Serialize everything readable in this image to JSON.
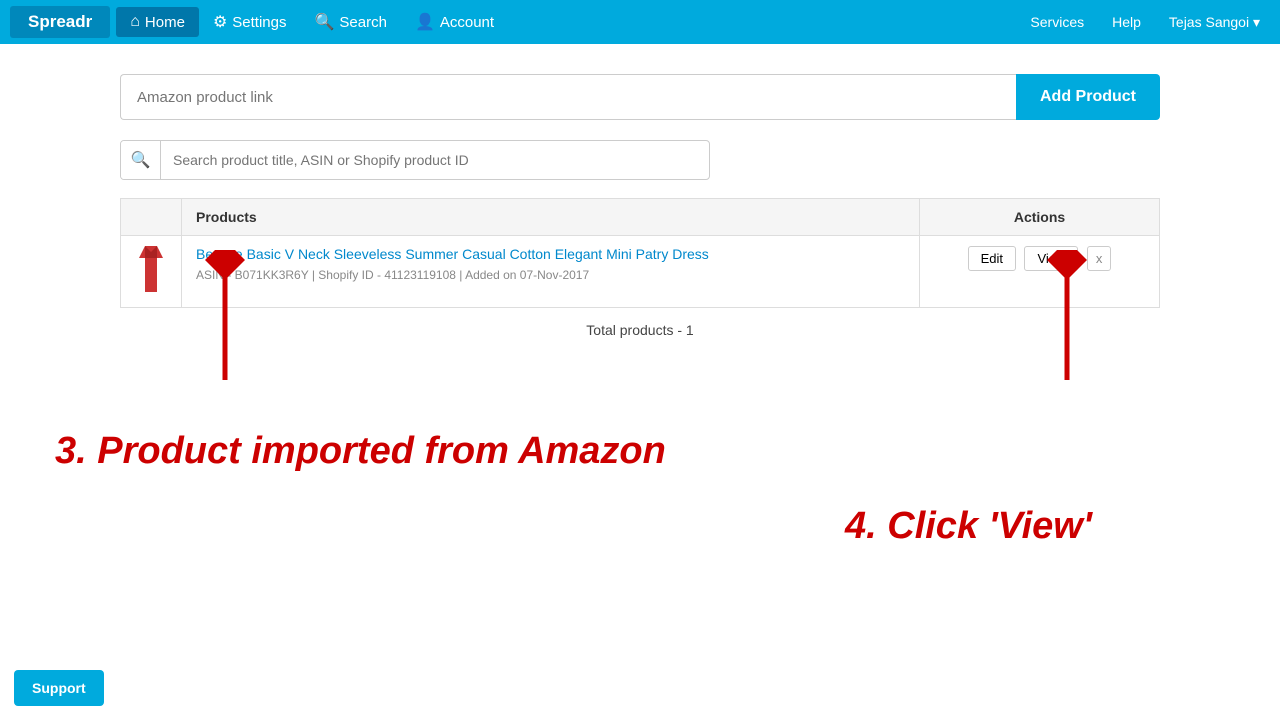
{
  "navbar": {
    "brand": "Spreadr",
    "home_label": "Home",
    "settings_label": "Settings",
    "search_label": "Search",
    "account_label": "Account",
    "services_label": "Services",
    "help_label": "Help",
    "user_label": "Tejas Sangoi ▾"
  },
  "add_product": {
    "placeholder": "Amazon product link",
    "button_label": "Add Product"
  },
  "search": {
    "placeholder": "Search product title, ASIN or Shopify product ID"
  },
  "table": {
    "col_products": "Products",
    "col_actions": "Actions",
    "rows": [
      {
        "title": "Beyove Basic V Neck Sleeveless Summer Casual Cotton Elegant Mini Patry Dress",
        "asin": "B071KK3R6Y",
        "shopify_id": "41123119108",
        "added_on": "07-Nov-2017",
        "meta": "ASIN - B071KK3R6Y  |  Shopify ID - 41123119108  |  Added on 07-Nov-2017"
      }
    ],
    "edit_label": "Edit",
    "view_label": "View",
    "delete_label": "x",
    "total_label": "Total products - 1"
  },
  "annotations": {
    "step3": "3. Product imported from Amazon",
    "step4": "4. Click 'View'"
  },
  "support_label": "Support"
}
